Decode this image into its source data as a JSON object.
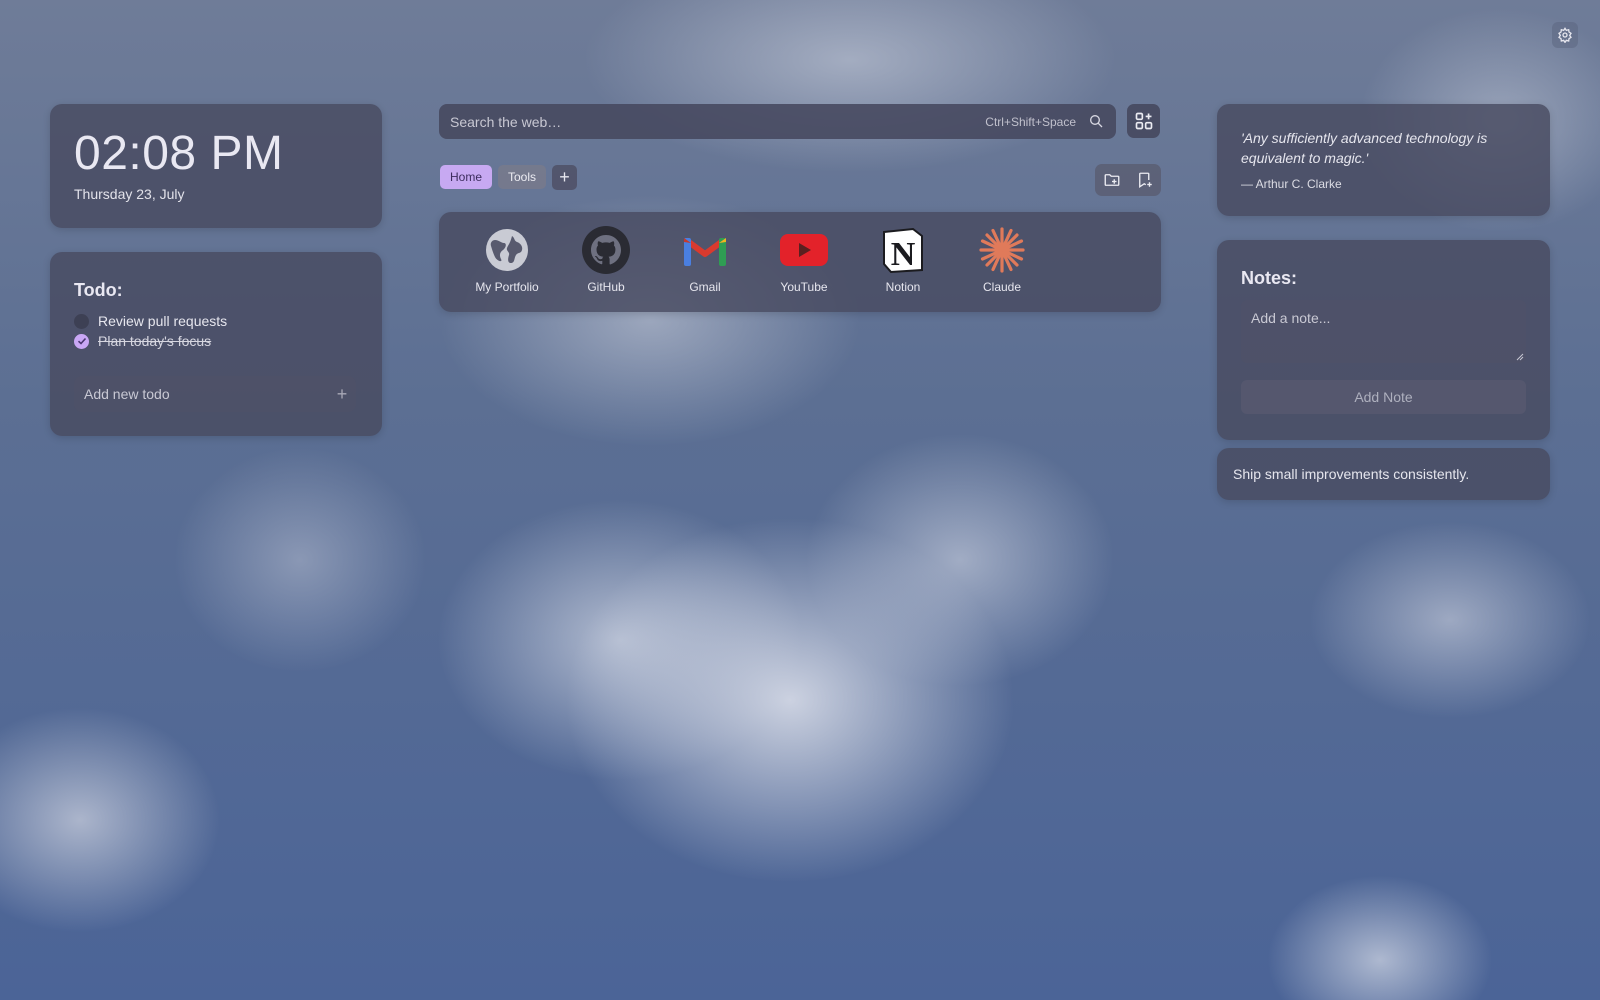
{
  "clock": {
    "time": "02:08 PM",
    "date": "Thursday 23, July"
  },
  "todo": {
    "title": "Todo:",
    "items": [
      {
        "text": "Review pull requests",
        "done": false
      },
      {
        "text": "Plan today's focus",
        "done": true
      }
    ],
    "input_placeholder": "Add new todo",
    "add_symbol": "+"
  },
  "search": {
    "placeholder": "Search the web…",
    "shortcut": "Ctrl+Shift+Space"
  },
  "tabs": [
    {
      "label": "Home",
      "active": true
    },
    {
      "label": "Tools",
      "active": false
    }
  ],
  "tab_add_symbol": "+",
  "shortcuts": [
    {
      "label": "My Portfolio",
      "icon": "globe-icon"
    },
    {
      "label": "GitHub",
      "icon": "github-icon"
    },
    {
      "label": "Gmail",
      "icon": "gmail-icon"
    },
    {
      "label": "YouTube",
      "icon": "youtube-icon"
    },
    {
      "label": "Notion",
      "icon": "notion-icon"
    },
    {
      "label": "Claude",
      "icon": "claude-icon"
    }
  ],
  "quote": {
    "text": "'Any sufficiently advanced technology is equivalent to magic.'",
    "author": "— Arthur C. Clarke"
  },
  "notes": {
    "title": "Notes:",
    "placeholder": "Add a note...",
    "add_label": "Add Note"
  },
  "motto": "Ship small improvements consistently.",
  "colors": {
    "accent": "#c7a9f2",
    "card": "#484a60",
    "claude": "#e07a5a",
    "youtube": "#e3222a"
  }
}
